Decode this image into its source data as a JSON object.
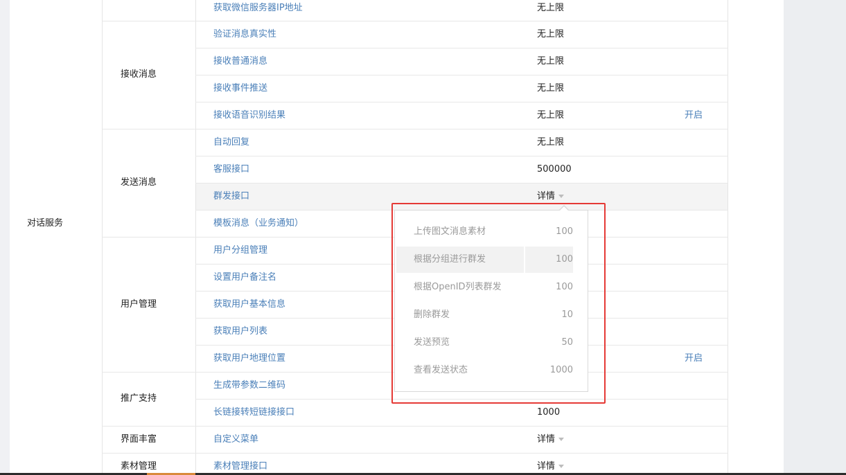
{
  "service_group": "对话服务",
  "categories": [
    {
      "label": "接收消息"
    },
    {
      "label": "发送消息"
    },
    {
      "label": "用户管理"
    },
    {
      "label": "推广支持"
    },
    {
      "label": "界面丰富"
    },
    {
      "label": "素材管理"
    }
  ],
  "rows": [
    {
      "name": "获取微信服务器IP地址",
      "limit": "无上限",
      "action": ""
    },
    {
      "name": "验证消息真实性",
      "limit": "无上限",
      "action": ""
    },
    {
      "name": "接收普通消息",
      "limit": "无上限",
      "action": ""
    },
    {
      "name": "接收事件推送",
      "limit": "无上限",
      "action": ""
    },
    {
      "name": "接收语音识别结果",
      "limit": "无上限",
      "action": "开启"
    },
    {
      "name": "自动回复",
      "limit": "无上限",
      "action": ""
    },
    {
      "name": "客服接口",
      "limit": "500000",
      "action": ""
    },
    {
      "name": "群发接口",
      "limit": "详情",
      "action": ""
    },
    {
      "name": "模板消息（业务通知）",
      "limit": "",
      "action": ""
    },
    {
      "name": "用户分组管理",
      "limit": "",
      "action": ""
    },
    {
      "name": "设置用户备注名",
      "limit": "",
      "action": ""
    },
    {
      "name": "获取用户基本信息",
      "limit": "",
      "action": ""
    },
    {
      "name": "获取用户列表",
      "limit": "",
      "action": ""
    },
    {
      "name": "获取用户地理位置",
      "limit": "",
      "action": "开启"
    },
    {
      "name": "生成带参数二维码",
      "limit": "",
      "action": ""
    },
    {
      "name": "长链接转短链接接口",
      "limit": "1000",
      "action": ""
    },
    {
      "name": "自定义菜单",
      "limit": "详情",
      "action": ""
    },
    {
      "name": "素材管理接口",
      "limit": "详情",
      "action": ""
    }
  ],
  "popup": {
    "items": [
      {
        "name": "上传图文消息素材",
        "value": "100"
      },
      {
        "name": "根据分组进行群发",
        "value": "100"
      },
      {
        "name": "根据OpenID列表群发",
        "value": "100"
      },
      {
        "name": "删除群发",
        "value": "10"
      },
      {
        "name": "发送预览",
        "value": "50"
      },
      {
        "name": "查看发送状态",
        "value": "1000"
      }
    ]
  },
  "colors": {
    "link": "#4a7fb8",
    "highlight_frame": "#e53935",
    "popup_text": "#9a9a9a"
  }
}
